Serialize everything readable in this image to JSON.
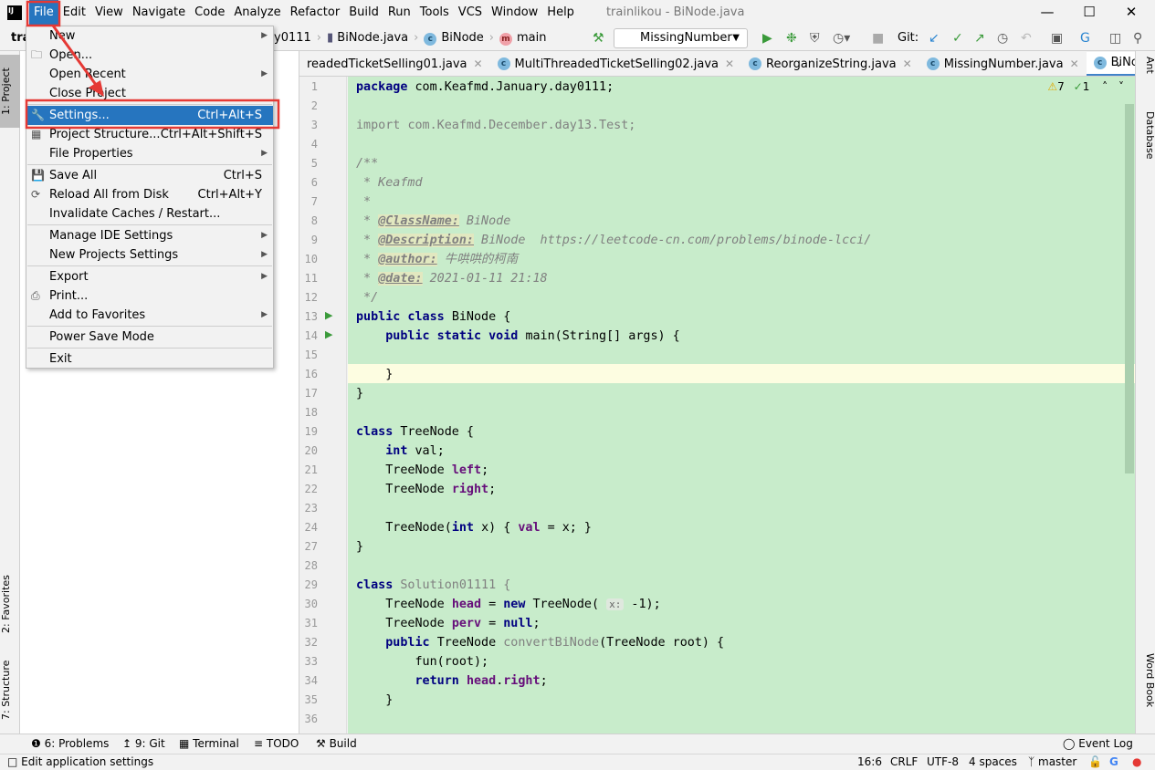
{
  "title": "trainlikou - BiNode.java",
  "menubar": [
    "File",
    "Edit",
    "View",
    "Navigate",
    "Code",
    "Analyze",
    "Refactor",
    "Build",
    "Run",
    "Tools",
    "VCS",
    "Window",
    "Help"
  ],
  "navbar": {
    "project": "tra",
    "crumbs": [
      "y0111",
      "BiNode.java",
      "BiNode",
      "main"
    ],
    "run_config": "MissingNumber",
    "git_label": "Git:"
  },
  "tabs": [
    {
      "label": "readedTicketSelling01.java"
    },
    {
      "label": "MultiThreadedTicketSelling02.java"
    },
    {
      "label": "ReorganizeString.java"
    },
    {
      "label": "MissingNumber.java"
    },
    {
      "label": "BiNode.java",
      "active": true
    }
  ],
  "inspections": {
    "warnings": "7",
    "ok": "1"
  },
  "file_menu": [
    {
      "label": "New",
      "arrow": true
    },
    {
      "label": "Open...",
      "icon": "folder-icon"
    },
    {
      "label": "Open Recent",
      "arrow": true
    },
    {
      "label": "Close Project"
    },
    {
      "sep": true
    },
    {
      "label": "Settings...",
      "shortcut": "Ctrl+Alt+S",
      "icon": "wrench-icon",
      "selected": true
    },
    {
      "label": "Project Structure...",
      "shortcut": "Ctrl+Alt+Shift+S",
      "icon": "structure-icon"
    },
    {
      "label": "File Properties",
      "arrow": true
    },
    {
      "sep": true
    },
    {
      "label": "Save All",
      "shortcut": "Ctrl+S",
      "icon": "save-icon"
    },
    {
      "label": "Reload All from Disk",
      "shortcut": "Ctrl+Alt+Y",
      "icon": "reload-icon"
    },
    {
      "label": "Invalidate Caches / Restart..."
    },
    {
      "sep": true
    },
    {
      "label": "Manage IDE Settings",
      "arrow": true
    },
    {
      "label": "New Projects Settings",
      "arrow": true
    },
    {
      "sep": true
    },
    {
      "label": "Export",
      "arrow": true
    },
    {
      "label": "Print...",
      "icon": "print-icon"
    },
    {
      "label": "Add to Favorites",
      "arrow": true
    },
    {
      "sep": true
    },
    {
      "label": "Power Save Mode"
    },
    {
      "sep": true
    },
    {
      "label": "Exit"
    }
  ],
  "left_tools": [
    "1: Project",
    "2: Favorites",
    "7: Structure"
  ],
  "right_tools": [
    "Ant",
    "Database",
    "Word Book"
  ],
  "code": [
    {
      "n": "1",
      "t": [
        [
          "package ",
          "kw"
        ],
        [
          "com.Keafmd.January.day0111;",
          ""
        ]
      ]
    },
    {
      "n": "2",
      "t": []
    },
    {
      "n": "3",
      "t": [
        [
          "import ",
          "gray"
        ],
        [
          "com.Keafmd.December.day13.Test;",
          "gray"
        ]
      ]
    },
    {
      "n": "4",
      "t": []
    },
    {
      "n": "5",
      "t": [
        [
          "/**",
          "cm"
        ]
      ]
    },
    {
      "n": "6",
      "t": [
        [
          " * Keafmd",
          "cm"
        ]
      ]
    },
    {
      "n": "7",
      "t": [
        [
          " *",
          "cm"
        ]
      ]
    },
    {
      "n": "8",
      "t": [
        [
          " * ",
          "cm"
        ],
        [
          "@ClassName:",
          "tag"
        ],
        [
          " BiNode",
          "cm"
        ]
      ]
    },
    {
      "n": "9",
      "t": [
        [
          " * ",
          "cm"
        ],
        [
          "@Description:",
          "tag"
        ],
        [
          " BiNode  https://leetcode-cn.com/problems/binode-lcci/",
          "cm"
        ]
      ]
    },
    {
      "n": "10",
      "t": [
        [
          " * ",
          "cm"
        ],
        [
          "@author:",
          "tag"
        ],
        [
          " 牛哄哄的柯南",
          "cm"
        ]
      ]
    },
    {
      "n": "11",
      "t": [
        [
          " * ",
          "cm"
        ],
        [
          "@date:",
          "tag"
        ],
        [
          " 2021-01-11 21:18",
          "cm"
        ]
      ]
    },
    {
      "n": "12",
      "t": [
        [
          " */",
          "cm"
        ]
      ]
    },
    {
      "n": "13",
      "t": [
        [
          "public class ",
          "kw"
        ],
        [
          "BiNode {",
          ""
        ]
      ]
    },
    {
      "n": "14",
      "t": [
        [
          "    public static void ",
          "kw"
        ],
        [
          "main(String[] args) {",
          ""
        ]
      ]
    },
    {
      "n": "15",
      "t": []
    },
    {
      "n": "16",
      "t": [
        [
          "    }",
          ""
        ]
      ]
    },
    {
      "n": "17",
      "t": [
        [
          "}",
          ""
        ]
      ]
    },
    {
      "n": "18",
      "t": []
    },
    {
      "n": "19",
      "t": [
        [
          "class ",
          "kw"
        ],
        [
          "TreeNode {",
          ""
        ]
      ]
    },
    {
      "n": "20",
      "t": [
        [
          "    int ",
          "kw"
        ],
        [
          "val",
          ""
        ],
        [
          ";",
          ""
        ]
      ]
    },
    {
      "n": "21",
      "t": [
        [
          "    TreeNode ",
          ""
        ],
        [
          "left",
          "fld"
        ],
        [
          ";",
          ""
        ]
      ]
    },
    {
      "n": "22",
      "t": [
        [
          "    TreeNode ",
          ""
        ],
        [
          "right",
          "fld"
        ],
        [
          ";",
          ""
        ]
      ]
    },
    {
      "n": "23",
      "t": []
    },
    {
      "n": "24",
      "t": [
        [
          "    TreeNode(",
          ""
        ],
        [
          "int ",
          "kw"
        ],
        [
          "x) { ",
          ""
        ],
        [
          "val",
          "fld"
        ],
        [
          " = x; }",
          ""
        ]
      ]
    },
    {
      "n": "27",
      "t": [
        [
          "}",
          ""
        ]
      ]
    },
    {
      "n": "28",
      "t": []
    },
    {
      "n": "29",
      "t": [
        [
          "class ",
          "kw"
        ],
        [
          "Solution01111 {",
          "gray"
        ]
      ]
    },
    {
      "n": "30",
      "t": [
        [
          "    TreeNode ",
          ""
        ],
        [
          "head",
          "fld"
        ],
        [
          " = ",
          ""
        ],
        [
          "new ",
          "kw"
        ],
        [
          "TreeNode( ",
          ""
        ],
        [
          "x:",
          "hint"
        ],
        [
          " -1);",
          ""
        ]
      ]
    },
    {
      "n": "31",
      "t": [
        [
          "    TreeNode ",
          ""
        ],
        [
          "perv",
          "fld"
        ],
        [
          " = ",
          ""
        ],
        [
          "null",
          "kw"
        ],
        [
          ";",
          ""
        ]
      ]
    },
    {
      "n": "32",
      "t": [
        [
          "    public ",
          "kw"
        ],
        [
          "TreeNode ",
          ""
        ],
        [
          "convertBiNode",
          "gray"
        ],
        [
          "(TreeNode root) {",
          ""
        ]
      ]
    },
    {
      "n": "33",
      "t": [
        [
          "        fun(root);",
          ""
        ]
      ]
    },
    {
      "n": "34",
      "t": [
        [
          "        return ",
          "kw"
        ],
        [
          "head",
          "fld"
        ],
        [
          ".",
          ""
        ],
        [
          "right",
          "fld"
        ],
        [
          ";",
          ""
        ]
      ]
    },
    {
      "n": "35",
      "t": [
        [
          "    }",
          ""
        ]
      ]
    },
    {
      "n": "36",
      "t": []
    }
  ],
  "bottom_tools": [
    "6: Problems",
    "9: Git",
    "Terminal",
    "TODO",
    "Build"
  ],
  "event_log": "Event Log",
  "status": {
    "message": "Edit application settings",
    "position": "16:6",
    "line_sep": "CRLF",
    "encoding": "UTF-8",
    "indent": "4 spaces",
    "branch": "master"
  },
  "colors": {
    "accent": "#2675bf",
    "editor_bg": "#c8eccb",
    "annotation": "#e53935"
  }
}
